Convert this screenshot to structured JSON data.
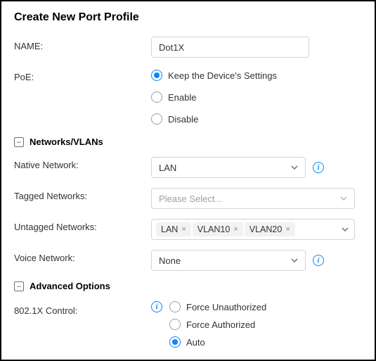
{
  "title": "Create New Port Profile",
  "name": {
    "label": "NAME:",
    "value": "Dot1X"
  },
  "poe": {
    "label": "PoE:",
    "options": [
      "Keep the Device's Settings",
      "Enable",
      "Disable"
    ],
    "selected": "Keep the Device's Settings"
  },
  "section_networks": {
    "label": "Networks/VLANs"
  },
  "native_network": {
    "label": "Native Network:",
    "value": "LAN"
  },
  "tagged_networks": {
    "label": "Tagged Networks:",
    "placeholder": "Please Select..."
  },
  "untagged_networks": {
    "label": "Untagged Networks:",
    "tags": [
      "LAN",
      "VLAN10",
      "VLAN20"
    ]
  },
  "voice_network": {
    "label": "Voice Network:",
    "value": "None"
  },
  "section_advanced": {
    "label": "Advanced Options"
  },
  "dot1x": {
    "label": "802.1X Control:",
    "options": [
      "Force Unauthorized",
      "Force Authorized",
      "Auto"
    ],
    "selected": "Auto"
  },
  "glyphs": {
    "minus": "−",
    "x": "×",
    "i": "i"
  }
}
